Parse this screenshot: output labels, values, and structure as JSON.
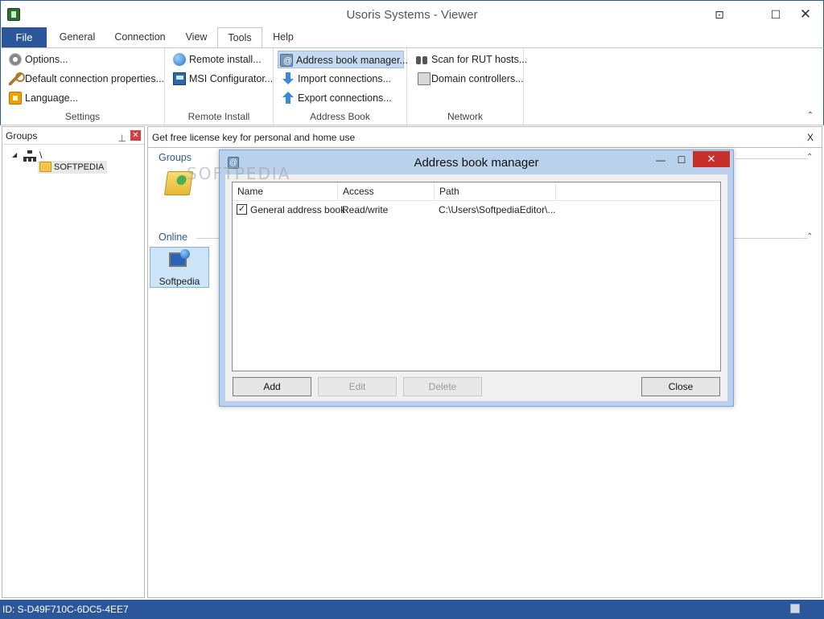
{
  "window": {
    "title": "Usoris Systems - Viewer",
    "restore_glyph": "⊡",
    "maximize_glyph": "☐",
    "close_glyph": "✕"
  },
  "tabs": {
    "file": "File",
    "general": "General",
    "connection": "Connection",
    "view": "View",
    "tools": "Tools",
    "help": "Help",
    "active": "Tools"
  },
  "ribbon": {
    "settings": {
      "label": "Settings",
      "items": [
        "Options...",
        "Default connection properties...",
        "Language..."
      ]
    },
    "remote_install": {
      "label": "Remote Install",
      "items": [
        "Remote install...",
        "MSI Configurator..."
      ]
    },
    "address_book": {
      "label": "Address Book",
      "items": [
        "Address book manager...",
        "Import connections...",
        "Export connections..."
      ]
    },
    "network": {
      "label": "Network",
      "items": [
        "Scan for RUT hosts...",
        "Domain controllers..."
      ]
    },
    "collapse_glyph": "⌃"
  },
  "groups_panel": {
    "title": "Groups",
    "pin_glyph": "⊥",
    "close_glyph": "✕",
    "tree_root": "\\",
    "tree_child": "SOFTPEDIA"
  },
  "main": {
    "license_text": "Get free license key for personal and home use",
    "license_close": "X",
    "groups_section": "Groups",
    "online_section": "Online",
    "online_host": "Softpedia",
    "collapse_glyph": "⌃"
  },
  "dialog": {
    "title": "Address book manager",
    "min_glyph": "—",
    "max_glyph": "☐",
    "close_glyph": "✕",
    "columns": [
      "Name",
      "Access",
      "Path"
    ],
    "rows": [
      {
        "checked": true,
        "check_glyph": "✓",
        "name": "General address book",
        "access": "Read/write",
        "path": "C:\\Users\\SoftpediaEditor\\..."
      }
    ],
    "buttons": {
      "add": "Add",
      "edit": "Edit",
      "delete": "Delete",
      "close": "Close"
    }
  },
  "watermark": "SOFTPEDIA",
  "status": {
    "id_text": "ID: S-D49F710C-6DC5-4EE7"
  },
  "colors": {
    "accent": "#2b579a",
    "dialog_frame": "#b9d1ea",
    "close_red": "#c7302b",
    "selected_tile": "#cce4f7"
  }
}
